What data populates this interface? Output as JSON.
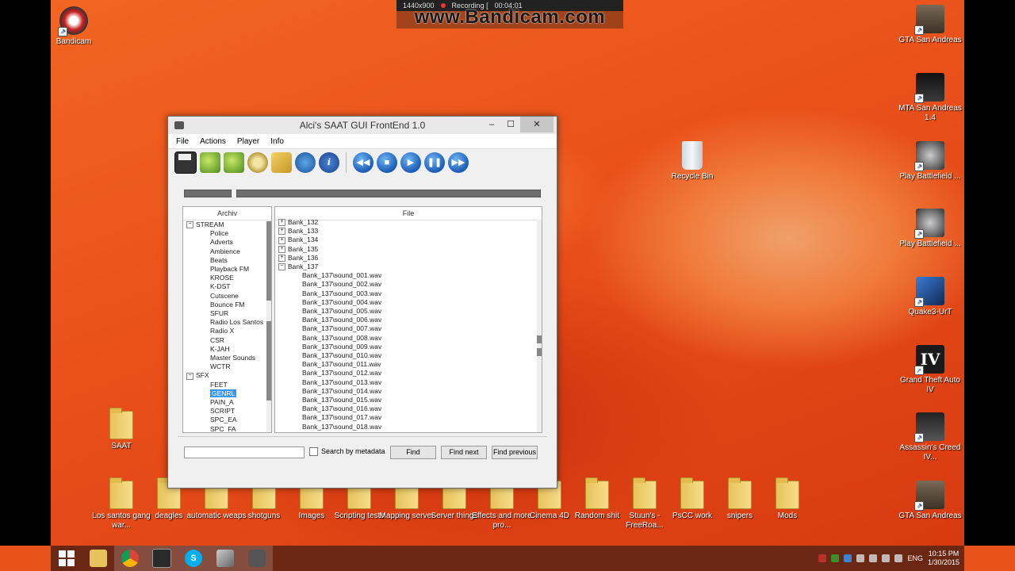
{
  "bandicam": {
    "resolution": "1440x900",
    "recording_label": "Recording [",
    "timer": "00:04:01",
    "watermark": "www.Bandicam.com"
  },
  "desktop_icons_left": [
    {
      "label": "Bandicam",
      "icon": "bandicam-icon"
    },
    {
      "label": "SAAT",
      "icon": "folder-icon"
    }
  ],
  "desktop_icons_right": [
    {
      "label": "GTA San Andreas",
      "icon": "gta-icon"
    },
    {
      "label": "MTA San Andreas 1.4",
      "icon": "mta-icon"
    },
    {
      "label": "Recycle Bin",
      "icon": "recycle-bin-icon"
    },
    {
      "label": "Play Battlefield ...",
      "icon": "battlefield-icon"
    },
    {
      "label": "Play Battlefield ...",
      "icon": "battlefield-icon"
    },
    {
      "label": "Quake3-UrT",
      "icon": "quake-icon"
    },
    {
      "label": "Grand Theft Auto IV",
      "icon": "gta4-icon"
    },
    {
      "label": "Assassin's Creed IV...",
      "icon": "assassins-creed-icon"
    },
    {
      "label": "GTA San Andreas",
      "icon": "gta-icon"
    }
  ],
  "desktop_folders_bottom": [
    "Los santos gang war...",
    "deagles",
    "automatic weaps",
    "shotguns",
    "Images",
    "Scripting tests",
    "Mapping server",
    "Server things",
    "Effects and more pro...",
    "Cinema 4D",
    "Random shit",
    "Stuun's - FreeRoa...",
    "PsCC work",
    "snipers",
    "Mods"
  ],
  "window": {
    "title": "Alci's SAAT GUI FrontEnd 1.0",
    "menu": [
      "File",
      "Actions",
      "Player",
      "Info"
    ],
    "left_header": "Archiv",
    "right_header": "File",
    "archive_tree": [
      {
        "label": "STREAM",
        "level": 0,
        "expander": "−"
      },
      {
        "label": "Police",
        "level": 1
      },
      {
        "label": "Adverts",
        "level": 1
      },
      {
        "label": "Ambience",
        "level": 1
      },
      {
        "label": "Beats",
        "level": 1
      },
      {
        "label": "Playback FM",
        "level": 1
      },
      {
        "label": "KROSE",
        "level": 1
      },
      {
        "label": "K-DST",
        "level": 1
      },
      {
        "label": "Cutscene",
        "level": 1
      },
      {
        "label": "Bounce FM",
        "level": 1
      },
      {
        "label": "SFUR",
        "level": 1
      },
      {
        "label": "Radio Los Santos",
        "level": 1
      },
      {
        "label": "Radio X",
        "level": 1
      },
      {
        "label": "CSR",
        "level": 1
      },
      {
        "label": "K-JAH",
        "level": 1
      },
      {
        "label": "Master Sounds",
        "level": 1
      },
      {
        "label": "WCTR",
        "level": 1
      },
      {
        "label": "SFX",
        "level": 0,
        "expander": "−"
      },
      {
        "label": "FEET",
        "level": 1
      },
      {
        "label": "GENRL",
        "level": 1,
        "selected": true
      },
      {
        "label": "PAIN_A",
        "level": 1
      },
      {
        "label": "SCRIPT",
        "level": 1
      },
      {
        "label": "SPC_EA",
        "level": 1
      },
      {
        "label": "SPC_FA",
        "level": 1
      }
    ],
    "file_tree": [
      {
        "label": "Bank_132",
        "level": 0,
        "expander": "+"
      },
      {
        "label": "Bank_133",
        "level": 0,
        "expander": "+"
      },
      {
        "label": "Bank_134",
        "level": 0,
        "expander": "+"
      },
      {
        "label": "Bank_135",
        "level": 0,
        "expander": "+"
      },
      {
        "label": "Bank_136",
        "level": 0,
        "expander": "+"
      },
      {
        "label": "Bank_137",
        "level": 0,
        "expander": "−"
      },
      {
        "label": "Bank_137\\sound_001.wav",
        "level": 1
      },
      {
        "label": "Bank_137\\sound_002.wav",
        "level": 1
      },
      {
        "label": "Bank_137\\sound_003.wav",
        "level": 1
      },
      {
        "label": "Bank_137\\sound_004.wav",
        "level": 1
      },
      {
        "label": "Bank_137\\sound_005.wav",
        "level": 1
      },
      {
        "label": "Bank_137\\sound_006.wav",
        "level": 1
      },
      {
        "label": "Bank_137\\sound_007.wav",
        "level": 1
      },
      {
        "label": "Bank_137\\sound_008.wav",
        "level": 1
      },
      {
        "label": "Bank_137\\sound_009.wav",
        "level": 1
      },
      {
        "label": "Bank_137\\sound_010.wav",
        "level": 1
      },
      {
        "label": "Bank_137\\sound_011.wav",
        "level": 1
      },
      {
        "label": "Bank_137\\sound_012.wav",
        "level": 1
      },
      {
        "label": "Bank_137\\sound_013.wav",
        "level": 1
      },
      {
        "label": "Bank_137\\sound_014.wav",
        "level": 1
      },
      {
        "label": "Bank_137\\sound_015.wav",
        "level": 1
      },
      {
        "label": "Bank_137\\sound_016.wav",
        "level": 1
      },
      {
        "label": "Bank_137\\sound_017.wav",
        "level": 1
      },
      {
        "label": "Bank_137\\sound_018.wav",
        "level": 1
      }
    ],
    "search": {
      "value": "",
      "checkbox_label": "Search by metadata",
      "find": "Find",
      "find_next": "Find next",
      "find_previous": "Find previous"
    }
  },
  "taskbar": {
    "language": "ENG",
    "time": "10:15 PM",
    "date": "1/30/2015"
  }
}
